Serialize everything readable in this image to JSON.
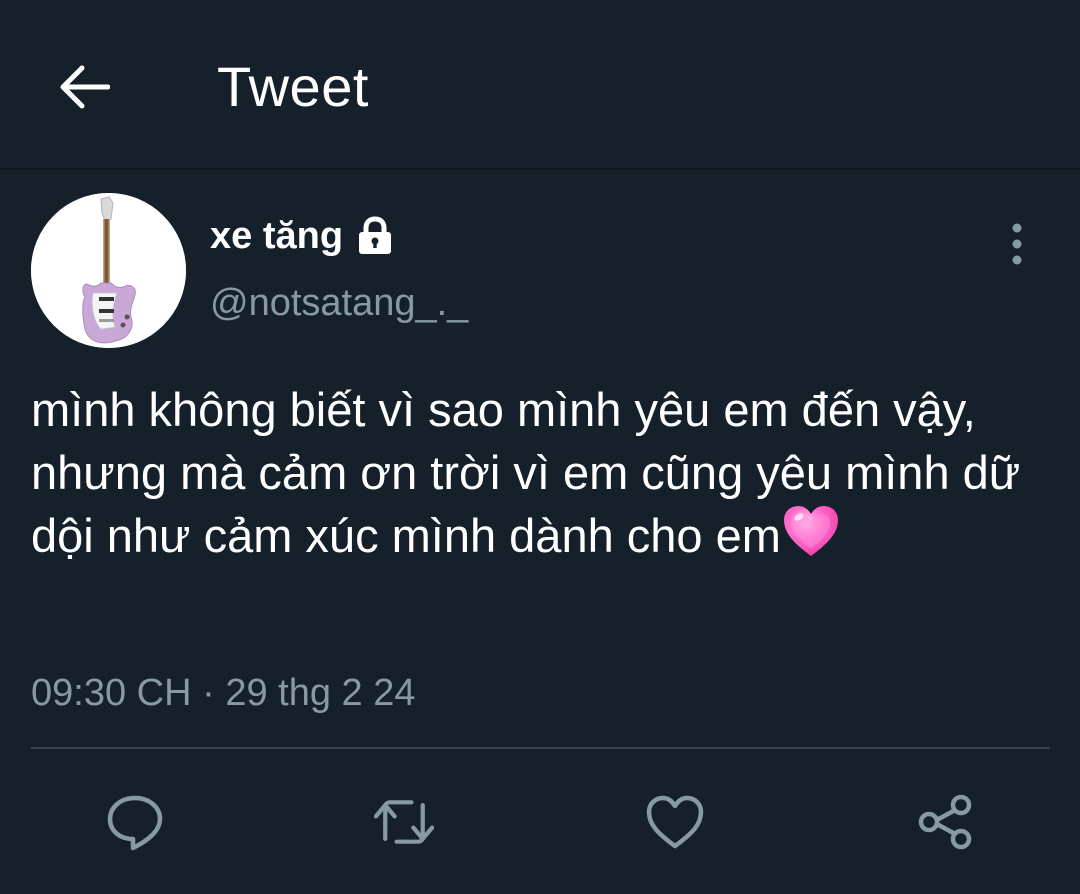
{
  "header": {
    "title": "Tweet",
    "back_icon": "arrow-left-icon"
  },
  "author": {
    "display_name": "xe tăng",
    "handle": "@notsatang_._",
    "protected_icon": "lock-icon",
    "avatar_icon": "guitar-avatar"
  },
  "tweet": {
    "text": "mình không biết vì sao mình yêu em đến vậy, nhưng mà cảm ơn trời vì em cũng yêu mình dữ dội như cảm xúc mình dành cho em",
    "emoji": "growing-heart-emoji",
    "time": "09:30 CH",
    "separator": "·",
    "date": "29 thg 2 24"
  },
  "actions": [
    {
      "name": "reply",
      "icon": "comment-icon"
    },
    {
      "name": "retweet",
      "icon": "retweet-icon"
    },
    {
      "name": "like",
      "icon": "heart-icon"
    },
    {
      "name": "share",
      "icon": "share-icon"
    }
  ],
  "colors": {
    "background": "#15202b",
    "secondary_text": "#8899a6",
    "divider": "#38444d",
    "icon": "#8899a6"
  }
}
